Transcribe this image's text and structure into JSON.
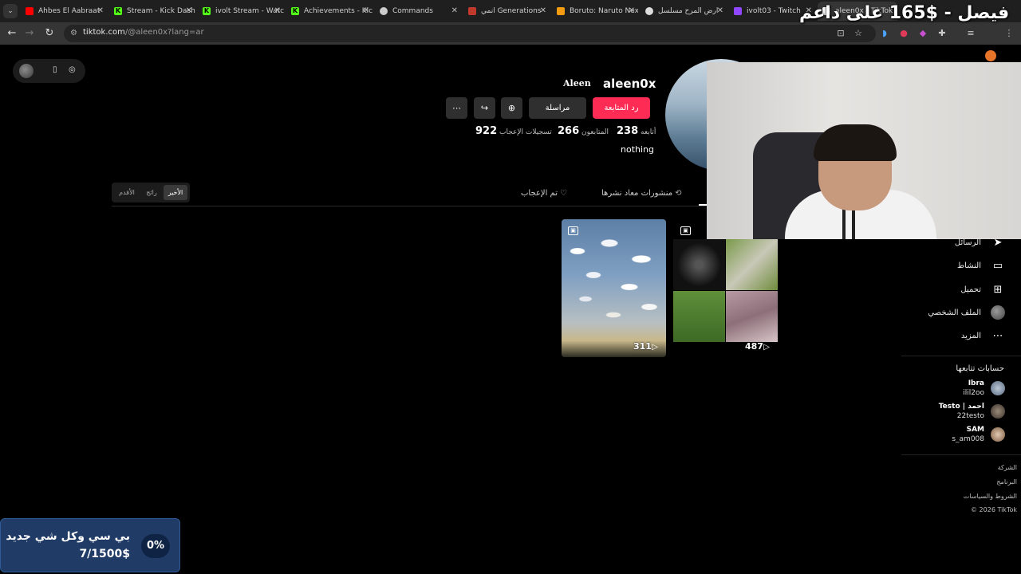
{
  "browser": {
    "tabs": [
      {
        "title": "Ahbes El Aabraat",
        "favicon_color": "#ff0000"
      },
      {
        "title": "Stream - Kick Dash",
        "favicon_color": "#53fc18"
      },
      {
        "title": "ivolt Stream - Watch",
        "favicon_color": "#53fc18"
      },
      {
        "title": "Achievements - Kick",
        "favicon_color": "#53fc18"
      },
      {
        "title": "Commands",
        "favicon_color": "#cccccc"
      },
      {
        "title": "انمي Generations",
        "favicon_color": "#c0392b"
      },
      {
        "title": "Boruto: Naruto Next",
        "favicon_color": "#f39c12"
      },
      {
        "title": "ارض المرح مسلسل",
        "favicon_color": "#dddddd"
      },
      {
        "title": "ivolt03 - Twitch",
        "favicon_color": "#9146ff"
      },
      {
        "title": "aleen0x | TikTok",
        "favicon_color": "#ffffff"
      }
    ],
    "url_host": "tiktok.com",
    "url_path": "/@aleen0x?lang=ar"
  },
  "overlay": {
    "title": "فيصل - $165 على داعم"
  },
  "profile": {
    "username": "aleen0x",
    "nickname": "Aleen",
    "follow_back_label": "رد المتابعة",
    "message_label": "مراسلة",
    "stats": [
      {
        "label": "أتابعه",
        "value": "238"
      },
      {
        "label": "المتابعون",
        "value": "266"
      },
      {
        "label": "تسجيلات الإعجاب",
        "value": "922"
      }
    ],
    "bio": "nothing",
    "tabs": [
      {
        "label": "منشورات معاد نشرها",
        "icon": "repost-icon"
      },
      {
        "label": "تم الإعجاب",
        "icon": "heart-off-icon"
      }
    ],
    "sort": [
      "الأخير",
      "رائج",
      "الأقدم"
    ]
  },
  "videos": [
    {
      "views": "311",
      "type": "photo"
    },
    {
      "views": "487",
      "type": "photo"
    }
  ],
  "sidebar": {
    "items": [
      {
        "label": "الرسائل",
        "icon": "send-icon"
      },
      {
        "label": "النشاط",
        "icon": "inbox-icon"
      },
      {
        "label": "تحميل",
        "icon": "upload-icon"
      },
      {
        "label": "الملف الشخصي",
        "icon": "avatar"
      },
      {
        "label": "المزيد",
        "icon": "more-icon"
      }
    ],
    "following_heading": "حسابات تتابعها",
    "accounts": [
      {
        "name": "Ibra",
        "handle": "ilil2oo"
      },
      {
        "name": "Testo | احمد",
        "handle": "22testo"
      },
      {
        "name": "SAM",
        "handle": "s_am008"
      }
    ],
    "footer": [
      "الشركة",
      "البرنامج",
      "الشروط والسياسات",
      "© 2026 TikTok"
    ]
  },
  "goal": {
    "title": "بي سي وكل شي جديد",
    "amount": "7/1500$",
    "percent": "0%"
  }
}
